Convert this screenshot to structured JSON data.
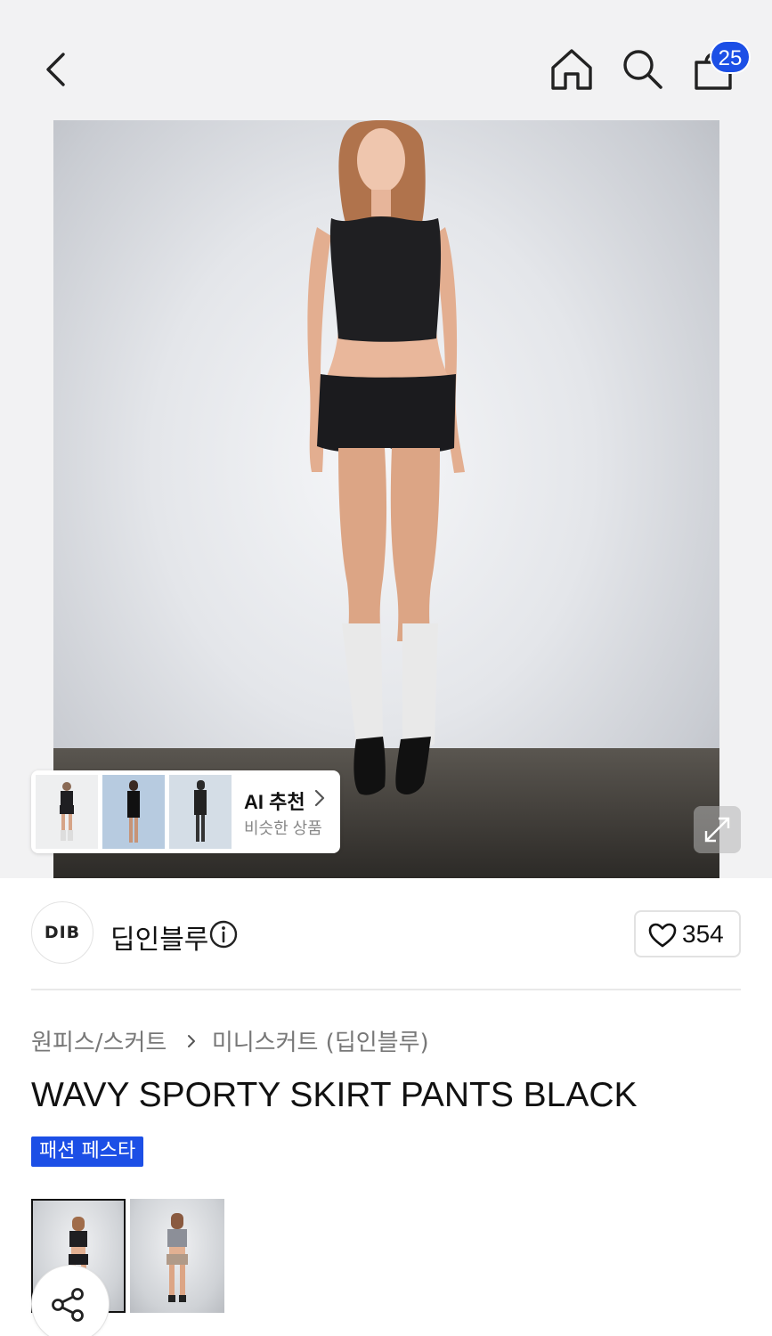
{
  "header": {
    "back_icon": "chevron-left-icon",
    "home_icon": "home-icon",
    "search_icon": "search-icon",
    "cart_icon": "shopping-bag-icon",
    "cart_count": "25"
  },
  "ai_recommend": {
    "title": "AI 추천",
    "subtitle": "비슷한 상품"
  },
  "brand": {
    "logo_text": "DIB",
    "name": "딥인블루",
    "like_count": "354"
  },
  "breadcrumb": {
    "category": "원피스/스커트",
    "subcategory": "미니스커트 (딥인블루)"
  },
  "product": {
    "title": "WAVY SPORTY SKIRT PANTS BLACK",
    "promo_badge": "패션 페스타"
  },
  "colors": {
    "accent": "#1c4fe6",
    "text": "#111111",
    "muted": "#777777"
  }
}
